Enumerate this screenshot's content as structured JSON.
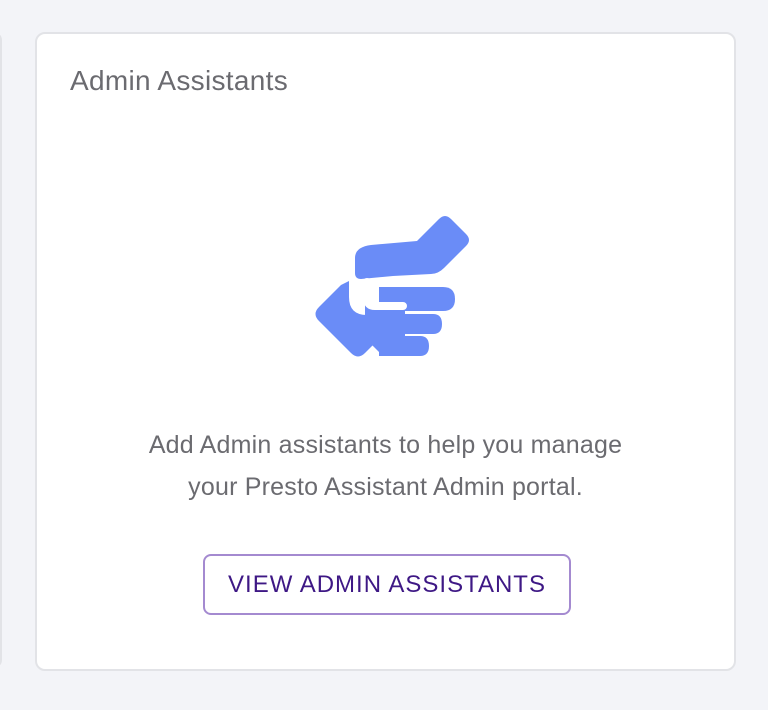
{
  "card": {
    "title": "Admin Assistants",
    "description_line1": "Add Admin assistants to help you manage",
    "description_line2": "your Presto Assistant Admin portal.",
    "button_label": "VIEW ADMIN ASSISTANTS",
    "icon": "handshake-icon"
  },
  "colors": {
    "page_background": "#f3f4f8",
    "card_background": "#ffffff",
    "icon_blue": "#6a8cf7",
    "button_text": "#3e1885",
    "button_border": "#a48ad0",
    "text_gray": "#6b6b70"
  }
}
